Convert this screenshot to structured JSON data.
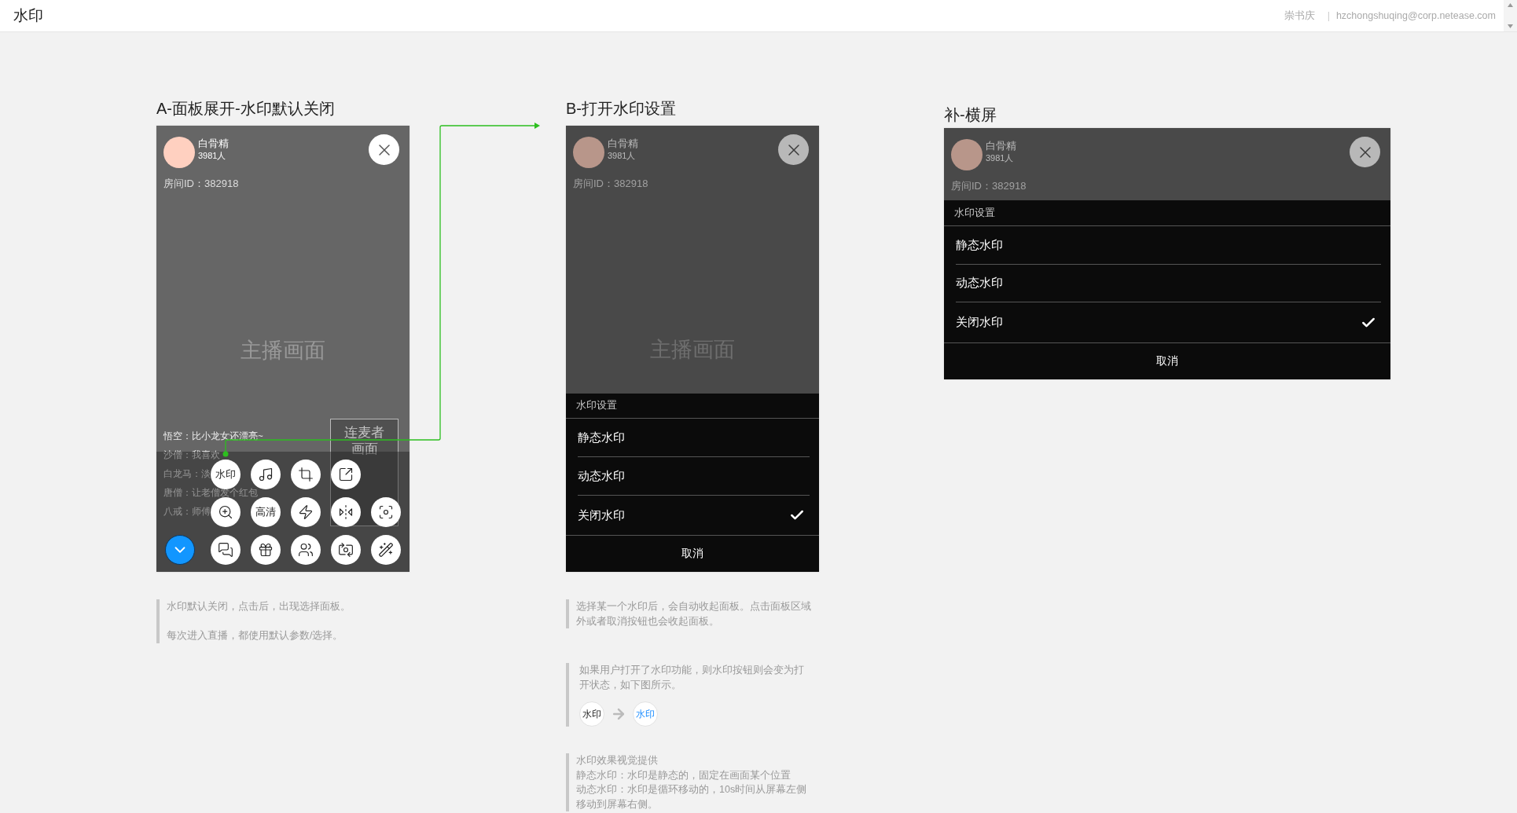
{
  "header": {
    "title": "水印",
    "author": "崇书庆",
    "separator": "|",
    "email": "hzchongshuqing@corp.netease.com"
  },
  "sections": [
    {
      "title": "A-面板展开-水印默认关闭",
      "phone": {
        "kind": "portrait",
        "dimmed": false,
        "anchor_name": "白骨精",
        "viewers": "3981人",
        "room_id": "房间ID：382918",
        "stream_label": "主播画面",
        "chat": [
          "悟空：比小龙女还漂亮~",
          "沙僧：我喜欢",
          "白龙马：淡",
          "唐僧：让老僧发个红包",
          "八戒：师傅"
        ],
        "cohost_label": [
          "连麦者",
          "画面"
        ],
        "control_rows": [
          [
            {
              "kind": "text",
              "label": "水印"
            },
            {
              "kind": "music"
            },
            {
              "kind": "crop"
            },
            {
              "kind": "share"
            }
          ],
          [
            {
              "kind": "zoom"
            },
            {
              "kind": "text",
              "label": "高清"
            },
            {
              "kind": "flash"
            },
            {
              "kind": "mirror"
            },
            {
              "kind": "focus"
            }
          ],
          [
            {
              "kind": "collapse"
            },
            {
              "kind": "chat"
            },
            {
              "kind": "gift"
            },
            {
              "kind": "people"
            },
            {
              "kind": "camera"
            },
            {
              "kind": "wand"
            }
          ]
        ]
      },
      "notes": [
        {
          "kind": "spaced",
          "paragraphs": [
            "水印默认关闭，点击后，出现选择面板。",
            "每次进入直播，都使用默认参数/选择。"
          ]
        }
      ]
    },
    {
      "title": "B-打开水印设置",
      "phone": {
        "kind": "portrait",
        "dimmed": true,
        "anchor_name": "白骨精",
        "viewers": "3981人",
        "room_id": "房间ID：382918",
        "stream_label": "主播画面",
        "sheet": {
          "title": "水印设置",
          "options": [
            {
              "label": "静态水印",
              "selected": false
            },
            {
              "label": "动态水印",
              "selected": false
            },
            {
              "label": "关闭水印",
              "selected": true
            }
          ],
          "cancel": "取消"
        }
      },
      "notes": [
        {
          "kind": "text",
          "paragraphs": [
            "选择某一个水印后，会自动收起面板。点击面板区域外或者取消按钮也会收起面板。"
          ]
        },
        {
          "kind": "demo",
          "paragraphs": [
            "如果用户打开了水印功能，则水印按钮则会变为打开状态，如下图所示。"
          ],
          "pills": [
            {
              "label": "水印",
              "on": false
            },
            {
              "label": "水印",
              "on": true
            }
          ]
        },
        {
          "kind": "text",
          "paragraphs": [
            "水印效果视觉提供",
            "静态水印：水印是静态的，固定在画面某个位置",
            "动态水印：水印是循环移动的，10s时间从屏幕左侧移动到屏幕右侧。"
          ]
        }
      ]
    },
    {
      "title": "补-横屏",
      "phone": {
        "kind": "landscape",
        "dimmed": true,
        "anchor_name": "白骨精",
        "viewers": "3981人",
        "room_id": "房间ID：382918",
        "sheet": {
          "title": "水印设置",
          "options": [
            {
              "label": "静态水印",
              "selected": false
            },
            {
              "label": "动态水印",
              "selected": false
            },
            {
              "label": "关闭水印",
              "selected": true
            }
          ],
          "cancel": "取消"
        }
      }
    }
  ]
}
